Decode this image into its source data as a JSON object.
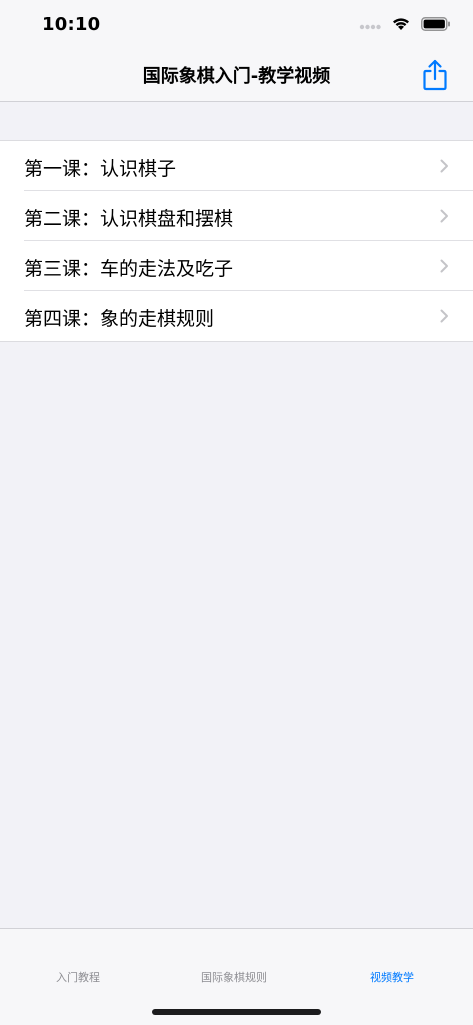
{
  "status_bar": {
    "time": "10:10",
    "signal_icon": "cellular-signal-icon",
    "wifi_icon": "wifi-icon",
    "battery_icon": "battery-icon"
  },
  "nav": {
    "title": "国际象棋入门-教学视频",
    "share_icon": "share-icon",
    "accent_color": "#007aff"
  },
  "lessons": [
    {
      "label": "第一课：认识棋子"
    },
    {
      "label": "第二课：认识棋盘和摆棋"
    },
    {
      "label": "第三课：车的走法及吃子"
    },
    {
      "label": "第四课：象的走棋规则"
    }
  ],
  "tabs": [
    {
      "label": "入门教程",
      "active": false
    },
    {
      "label": "国际象棋规则",
      "active": false
    },
    {
      "label": "视频教学",
      "active": true
    }
  ]
}
